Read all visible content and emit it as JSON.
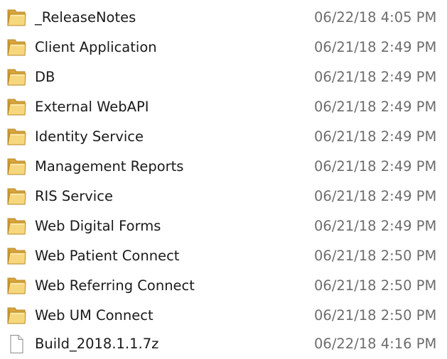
{
  "colors": {
    "folder_back": "#d8a43c",
    "folder_front": "#f6d77e",
    "folder_edge": "#b98a26",
    "name_text": "#1a1a1a",
    "date_text": "#6d6d6d"
  },
  "files": [
    {
      "name": "_ReleaseNotes",
      "modified": "06/22/18 4:05 PM",
      "icon": "folder-icon"
    },
    {
      "name": "Client Application",
      "modified": "06/21/18 2:49 PM",
      "icon": "folder-icon"
    },
    {
      "name": "DB",
      "modified": "06/21/18 2:49 PM",
      "icon": "folder-icon"
    },
    {
      "name": "External WebAPI",
      "modified": "06/21/18 2:49 PM",
      "icon": "folder-icon"
    },
    {
      "name": "Identity Service",
      "modified": "06/21/18 2:49 PM",
      "icon": "folder-icon"
    },
    {
      "name": "Management Reports",
      "modified": "06/21/18 2:49 PM",
      "icon": "folder-icon"
    },
    {
      "name": "RIS Service",
      "modified": "06/21/18 2:49 PM",
      "icon": "folder-icon"
    },
    {
      "name": "Web Digital Forms",
      "modified": "06/21/18 2:49 PM",
      "icon": "folder-icon"
    },
    {
      "name": "Web Patient Connect",
      "modified": "06/21/18 2:50 PM",
      "icon": "folder-icon"
    },
    {
      "name": "Web Referring Connect",
      "modified": "06/21/18 2:50 PM",
      "icon": "folder-icon"
    },
    {
      "name": "Web UM Connect",
      "modified": "06/21/18 2:50 PM",
      "icon": "folder-icon"
    },
    {
      "name": "Build_2018.1.1.7z",
      "modified": "06/22/18 4:16 PM",
      "icon": "file-icon"
    }
  ]
}
